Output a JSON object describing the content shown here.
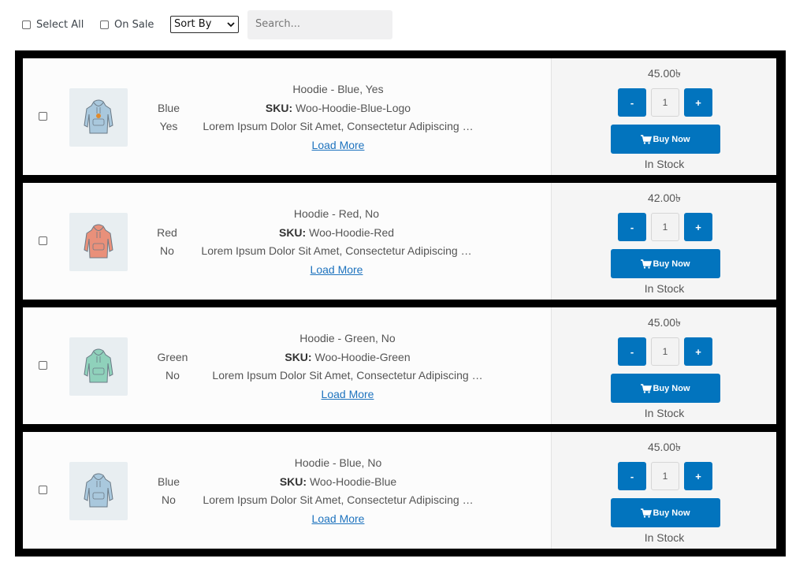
{
  "toolbar": {
    "select_all_label": "Select All",
    "on_sale_label": "On Sale",
    "sort_selected": "Sort By",
    "search_placeholder": "Search..."
  },
  "currency_symbol": "৳",
  "labels": {
    "sku_key": "SKU:",
    "load_more": "Load More",
    "buy_now": "Buy Now",
    "minus": "-",
    "plus": "+"
  },
  "colors": {
    "accent": "#0274be",
    "hoodie_blue": "#a9c8dd",
    "hoodie_red": "#e9907a",
    "hoodie_green": "#8fd1bb"
  },
  "products": [
    {
      "attr1": "Blue",
      "attr2": "Yes",
      "name": "Hoodie - Blue, Yes",
      "sku": "Woo-Hoodie-Blue-Logo",
      "description": "Lorem Ipsum Dolor Sit Amet, Consectetur Adipiscing …",
      "price": "45.00৳",
      "quantity": "1",
      "stock": "In Stock",
      "icon": "hoodie-blue-logo-icon"
    },
    {
      "attr1": "Red",
      "attr2": "No",
      "name": "Hoodie - Red, No",
      "sku": "Woo-Hoodie-Red",
      "description": "Lorem Ipsum Dolor Sit Amet, Consectetur Adipiscing …",
      "price": "42.00৳",
      "quantity": "1",
      "stock": "In Stock",
      "icon": "hoodie-red-icon"
    },
    {
      "attr1": "Green",
      "attr2": "No",
      "name": "Hoodie - Green, No",
      "sku": "Woo-Hoodie-Green",
      "description": "Lorem Ipsum Dolor Sit Amet, Consectetur Adipiscing …",
      "price": "45.00৳",
      "quantity": "1",
      "stock": "In Stock",
      "icon": "hoodie-green-icon"
    },
    {
      "attr1": "Blue",
      "attr2": "No",
      "name": "Hoodie - Blue, No",
      "sku": "Woo-Hoodie-Blue",
      "description": "Lorem Ipsum Dolor Sit Amet, Consectetur Adipiscing …",
      "price": "45.00৳",
      "quantity": "1",
      "stock": "In Stock",
      "icon": "hoodie-blue-icon"
    }
  ]
}
